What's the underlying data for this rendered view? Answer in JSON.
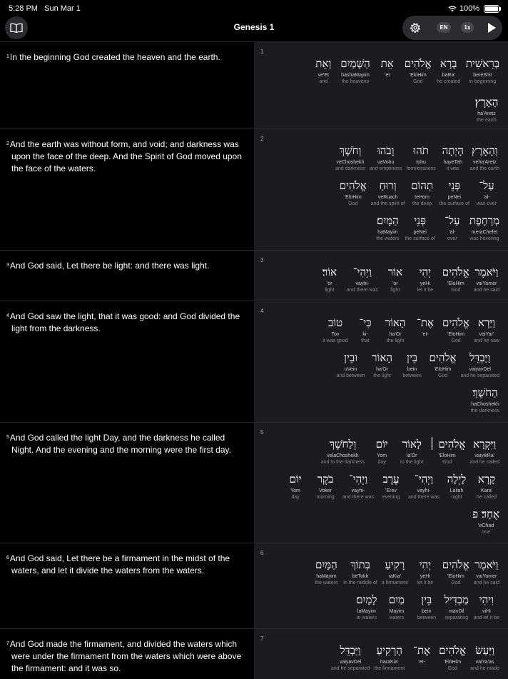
{
  "status": {
    "time": "5:28 PM",
    "date": "Sun Mar 1",
    "battery": "100%"
  },
  "header": {
    "title": "Genesis 1",
    "lang": "EN",
    "speed": "1x"
  },
  "verses": [
    {
      "num": "1",
      "text": "In the beginning God created the heaven and the earth.",
      "rows": [
        [
          {
            "h": "בְּרֵאשִׁית",
            "t": "bereShit",
            "g": "in beginning"
          },
          {
            "h": "בָּרָא",
            "t": "baRa'",
            "g": "he created"
          },
          {
            "h": "אֱלֹהִים",
            "t": "'EloHim",
            "g": "God"
          },
          {
            "h": "אֵת",
            "t": "'et",
            "g": ""
          },
          {
            "h": "הַשָּׁמַיִם",
            "t": "hashaMayim",
            "g": "the heavens"
          },
          {
            "h": "וְאֵת",
            "t": "ve'Et",
            "g": "and"
          }
        ],
        [
          {
            "h": "הָאָרֶץ׃",
            "t": "ha'Aretz",
            "g": "the earth"
          }
        ]
      ]
    },
    {
      "num": "2",
      "text": "And the earth was without form, and void; and darkness was upon the face of the deep. And the Spirit of God moved upon the face of the waters.",
      "rows": [
        [
          {
            "h": "וְהָאָרֶץ",
            "t": "veha'Aretz",
            "g": "and the earth"
          },
          {
            "h": "הָיְתָה",
            "t": "hayeTah",
            "g": "it was"
          },
          {
            "h": "תֹהוּ",
            "t": "tohu",
            "g": "formlessness"
          },
          {
            "h": "וָבֹהוּ",
            "t": "vaVohu",
            "g": "and emptiness"
          },
          {
            "h": "וְחֹשֶׁךְ",
            "t": "veChoshekh",
            "g": "and darkness"
          }
        ],
        [
          {
            "h": "עַל־",
            "t": "'al-",
            "g": "was over"
          },
          {
            "h": "פְּנֵי",
            "t": "peNei",
            "g": "the surface of"
          },
          {
            "h": "תְהוֹם",
            "t": "teHom",
            "g": "the deep"
          },
          {
            "h": "וְרוּחַ",
            "t": "veRuach",
            "g": "and the spirit of"
          },
          {
            "h": "אֱלֹהִים",
            "t": "'ElоHim",
            "g": "God"
          }
        ],
        [
          {
            "h": "מְרַחֶפֶת",
            "t": "meraChefet",
            "g": "was hovering"
          },
          {
            "h": "עַל־",
            "t": "'al-",
            "g": "over"
          },
          {
            "h": "פְּנֵי",
            "t": "peNei",
            "g": "the surface of"
          },
          {
            "h": "הַמָּיִם׃",
            "t": "haMayim",
            "g": "the waters"
          }
        ]
      ]
    },
    {
      "num": "3",
      "text": "And God said, Let there be light: and there was light.",
      "rows": [
        [
          {
            "h": "וַיֹּאמֶר",
            "t": "vaiYomer",
            "g": "and he said"
          },
          {
            "h": "אֱלֹהִים",
            "t": "'ElоHim",
            "g": "God"
          },
          {
            "h": "יְהִי",
            "t": "yeHi",
            "g": "let it be"
          },
          {
            "h": "אוֹר",
            "t": "'or",
            "g": "light"
          },
          {
            "h": "וַיְהִי־",
            "t": "vayhi-",
            "g": "and there was"
          },
          {
            "h": "אוֹר׃",
            "t": "'or",
            "g": "light"
          }
        ]
      ]
    },
    {
      "num": "4",
      "text": "And God saw the light, that it was good: and God divided the light from the darkness.",
      "rows": [
        [
          {
            "h": "וַיַּרְא",
            "t": "vaiYar'",
            "g": "and he saw"
          },
          {
            "h": "אֱלֹהִים",
            "t": "'ElоHim",
            "g": "God"
          },
          {
            "h": "אֶת־",
            "t": "'et-",
            "g": ""
          },
          {
            "h": "הָאוֹר",
            "t": "ha'Or",
            "g": "the light"
          },
          {
            "h": "כִּי־",
            "t": "ki-",
            "g": "that"
          },
          {
            "h": "טוֹב",
            "t": "Tov",
            "g": "it was good"
          }
        ],
        [
          {
            "h": "וַיַּבְדֵּל",
            "t": "vaiyavDel",
            "g": "and he separated"
          },
          {
            "h": "אֱלֹהִים",
            "t": "'ElоHim",
            "g": "God"
          },
          {
            "h": "בֵּין",
            "t": "bein",
            "g": "between"
          },
          {
            "h": "הָאוֹר",
            "t": "ha'Or",
            "g": "the light"
          },
          {
            "h": "וּבֵין",
            "t": "uVein",
            "g": "and between"
          }
        ],
        [
          {
            "h": "הַחֹשֶׁךְ׃",
            "t": "haChoshekh",
            "g": "the darkness"
          }
        ]
      ]
    },
    {
      "num": "5",
      "text": "And God called the light Day, and the darkness he called Night. And the evening and the morning were the first day.",
      "rows": [
        [
          {
            "h": "וַיִּקְרָא",
            "t": "vaiyikRa'",
            "g": "and he called"
          },
          {
            "h": "אֱלֹהִים ׀",
            "t": "'ElоHim",
            "g": "God"
          },
          {
            "h": "לָאוֹר",
            "t": "la'Or",
            "g": "to the light"
          },
          {
            "h": "יוֹם",
            "t": "Yom",
            "g": "day"
          },
          {
            "h": "וְלַחֹשֶׁךְ",
            "t": "velaChoshekh",
            "g": "and to the darkness"
          }
        ],
        [
          {
            "h": "קָרָא",
            "t": "Kara'",
            "g": "he called"
          },
          {
            "h": "לָיְלָה",
            "t": "Lailah",
            "g": "night"
          },
          {
            "h": "וַיְהִי־",
            "t": "vayhi-",
            "g": "and there was"
          },
          {
            "h": "עֶרֶב",
            "t": "'Erev",
            "g": "evening"
          },
          {
            "h": "וַיְהִי־",
            "t": "vayhi-",
            "g": "and there was"
          },
          {
            "h": "בֹקֶר",
            "t": "Voker",
            "g": "morning"
          },
          {
            "h": "יוֹם",
            "t": "Yom",
            "g": "day"
          }
        ],
        [
          {
            "h": "אֶחָד׃ פ",
            "t": "'eChad",
            "g": "one"
          }
        ]
      ]
    },
    {
      "num": "6",
      "text": "And God said, Let there be a firmament in the midst of the waters, and let it divide the waters from the waters.",
      "rows": [
        [
          {
            "h": "וַיֹּאמֶר",
            "t": "vaiYomer",
            "g": "and he said"
          },
          {
            "h": "אֱלֹהִים",
            "t": "'ElоHim",
            "g": "God"
          },
          {
            "h": "יְהִי",
            "t": "yeHi",
            "g": "let it be"
          },
          {
            "h": "רָקִיעַ",
            "t": "raKia'",
            "g": "a firmament"
          },
          {
            "h": "בְּתוֹךְ",
            "t": "beTokh",
            "g": "in the middle of"
          },
          {
            "h": "הַמָּיִם",
            "t": "haMayim",
            "g": "the waters"
          }
        ],
        [
          {
            "h": "וִיהִי",
            "t": "viHi",
            "g": "and let it be"
          },
          {
            "h": "מַבְדִּיל",
            "t": "mavDil",
            "g": "separating"
          },
          {
            "h": "בֵּין",
            "t": "bein",
            "g": "between"
          },
          {
            "h": "מַיִם",
            "t": "Mayim",
            "g": "waters"
          },
          {
            "h": "לָמָיִם׃",
            "t": "laMayim",
            "g": "to waters"
          }
        ]
      ]
    },
    {
      "num": "7",
      "text": "And God made the firmament, and divided the waters which were under the firmament from the waters which were above the firmament: and it was so.",
      "rows": [
        [
          {
            "h": "וַיַּעַשׂ",
            "t": "vaiYa'as",
            "g": "and he made"
          },
          {
            "h": "אֱלֹהִים",
            "t": "'ElоHim",
            "g": "God"
          },
          {
            "h": "אֶת־",
            "t": "'et-",
            "g": ""
          },
          {
            "h": "הָרָקִיעַ",
            "t": "haraKia'",
            "g": "the firmament"
          },
          {
            "h": "וַיַּבְדֵּל",
            "t": "vaiyavDel",
            "g": "and he separated"
          }
        ]
      ]
    }
  ]
}
